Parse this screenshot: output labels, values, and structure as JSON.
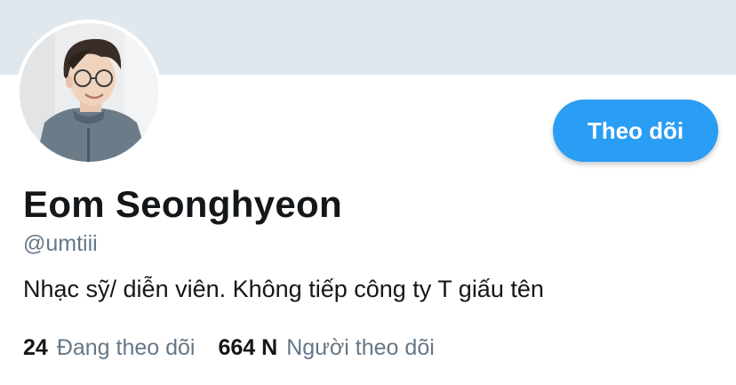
{
  "profile": {
    "name": "Eom Seonghyeon",
    "handle": "@umtiii",
    "bio": "Nhạc sỹ/ diễn viên. Không tiếp công ty T giấu tên",
    "follow_label": "Theo dõi"
  },
  "stats": {
    "following_count": "24",
    "following_label": "Đang theo dõi",
    "followers_count": "664 N",
    "followers_label": "Người theo dõi"
  },
  "colors": {
    "banner": "#e1e8ed",
    "accent": "#2a9df4",
    "text_primary": "#14171a",
    "text_secondary": "#657786"
  },
  "icons": {
    "avatar": "profile-photo"
  }
}
